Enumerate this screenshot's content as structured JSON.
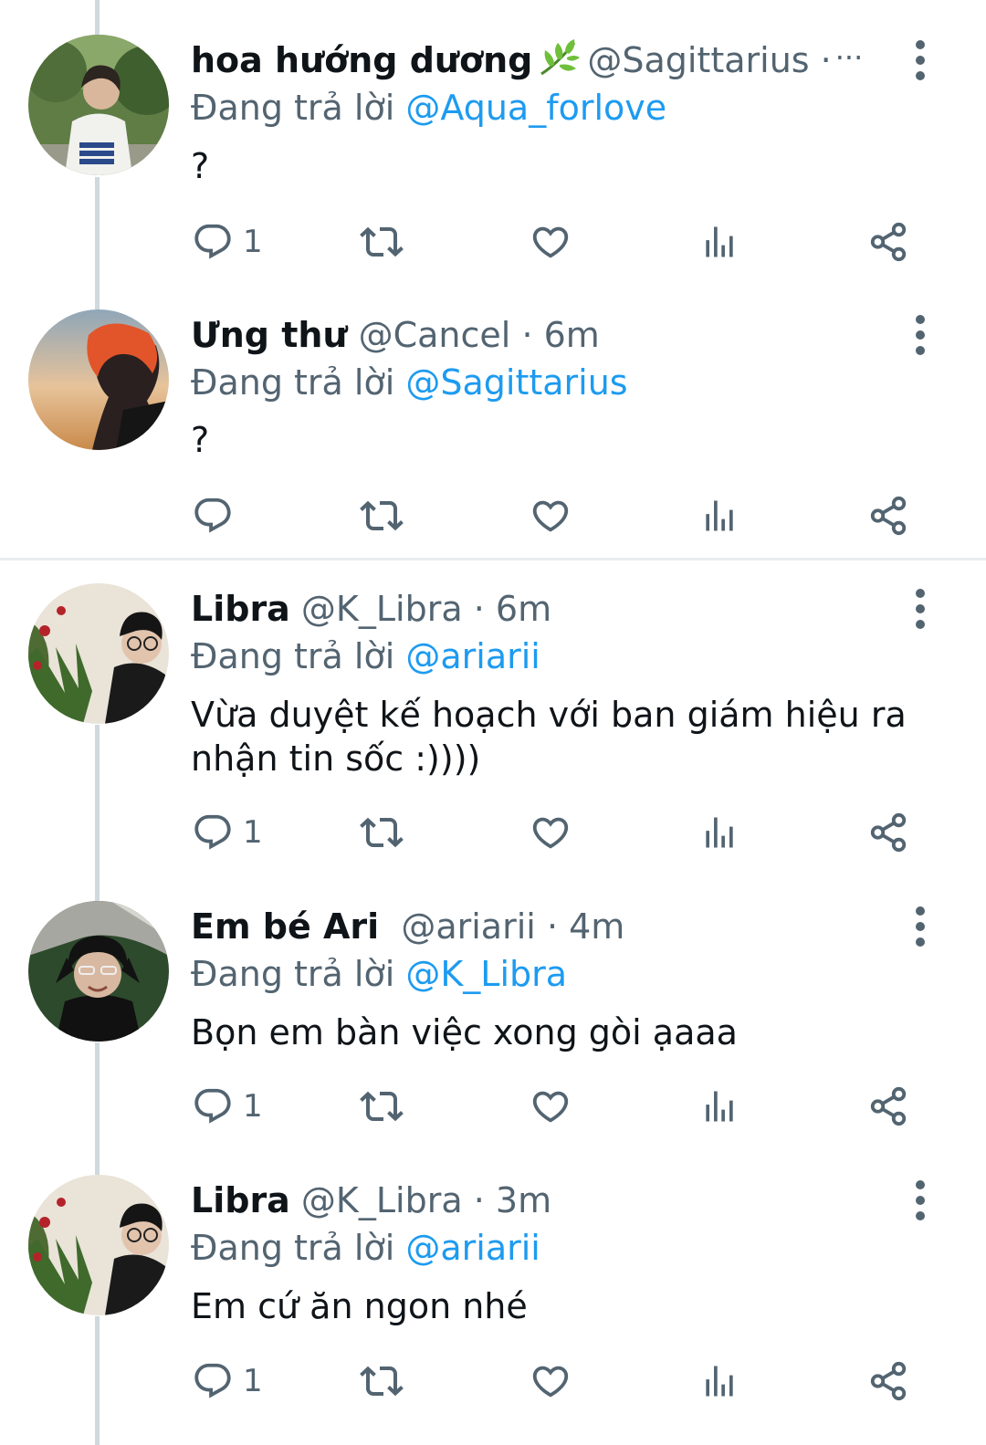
{
  "reply_prefix": "Đang trả lời",
  "separator": "·",
  "tweets": [
    {
      "name": "hoa hướng dương",
      "name_emoji": "leaf-emoji",
      "handle": "@Sagittarius",
      "time": "",
      "overflow": "···",
      "reply_to": "@Aqua_forlove",
      "text": "?",
      "reply_count": "1"
    },
    {
      "name": "Ưng thư",
      "handle": "@Cancel",
      "time": "6m",
      "reply_to": "@Sagittarius",
      "text": "?",
      "reply_count": ""
    },
    {
      "name": "Libra",
      "handle": "@K_Libra",
      "time": "6m",
      "reply_to": "@ariarii",
      "text": "Vừa duyệt kế hoạch với ban giám hiệu ra nhận tin sốc :))))",
      "reply_count": "1"
    },
    {
      "name": "Em bé Ari",
      "handle": "@ariarii",
      "time": "4m",
      "reply_to": "@K_Libra",
      "text": "Bọn em bàn việc xong gòi ạaaa",
      "reply_count": "1"
    },
    {
      "name": "Libra",
      "handle": "@K_Libra",
      "time": "3m",
      "reply_to": "@ariarii",
      "text": "Em cứ ăn ngon nhé",
      "reply_count": "1"
    }
  ],
  "icons": {
    "reply": "reply-icon",
    "retweet": "retweet-icon",
    "like": "heart-icon",
    "views": "views-icon",
    "share": "share-icon",
    "more": "more-vertical-icon"
  },
  "colors": {
    "text": "#0f1419",
    "secondary": "#536471",
    "link": "#1d9bf0",
    "thread_line": "#cfd9de"
  }
}
